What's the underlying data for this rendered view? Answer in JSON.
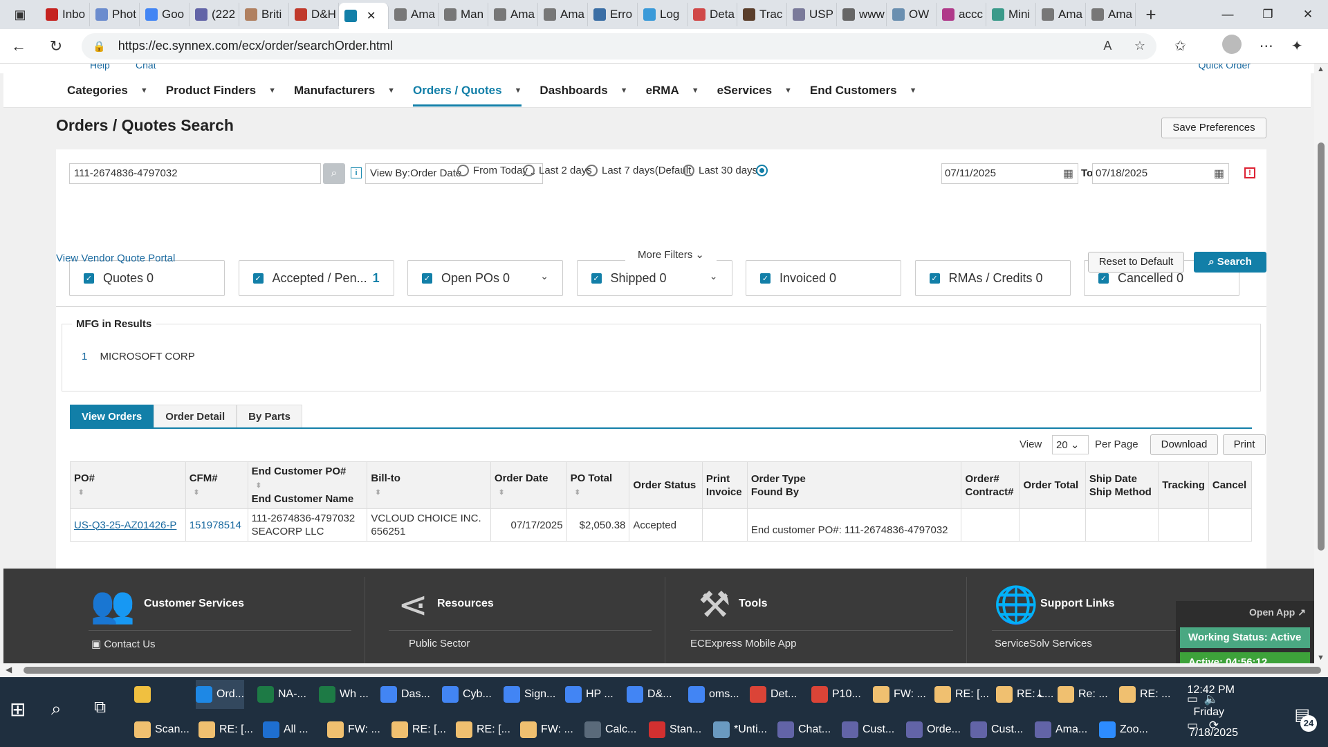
{
  "browser": {
    "tabs": [
      {
        "label": "Inbo",
        "color": "#c5221f"
      },
      {
        "label": "Phot",
        "color": "#6b8cce"
      },
      {
        "label": "Goo",
        "color": "#4285f4"
      },
      {
        "label": "(222",
        "color": "#6264a7"
      },
      {
        "label": "Briti",
        "color": "#b08060"
      },
      {
        "label": "D&H",
        "color": "#c0392b"
      },
      {
        "label": "",
        "color": "#127fa8",
        "active": true
      },
      {
        "label": "Ama",
        "color": "#777777"
      },
      {
        "label": "Man",
        "color": "#777777"
      },
      {
        "label": "Ama",
        "color": "#777777"
      },
      {
        "label": "Ama",
        "color": "#777777"
      },
      {
        "label": "Erro",
        "color": "#3a6ea5"
      },
      {
        "label": "Log",
        "color": "#3a9ad9"
      },
      {
        "label": "Deta",
        "color": "#d04848"
      },
      {
        "label": "Trac",
        "color": "#5a3e2b"
      },
      {
        "label": "USP",
        "color": "#7a7a9a"
      },
      {
        "label": "www",
        "color": "#666666"
      },
      {
        "label": "OW",
        "color": "#6a8fb0"
      },
      {
        "label": "accc",
        "color": "#b03a8a"
      },
      {
        "label": "Mini",
        "color": "#3a9a8a"
      },
      {
        "label": "Ama",
        "color": "#777777"
      },
      {
        "label": "Ama",
        "color": "#777777"
      }
    ],
    "url": "https://ec.synnex.com/ecx/order/searchOrder.html"
  },
  "header": {
    "help": "Help",
    "chat": "Chat",
    "quick_order": "Quick Order",
    "nav": [
      {
        "label": "Categories"
      },
      {
        "label": "Product Finders"
      },
      {
        "label": "Manufacturers"
      },
      {
        "label": "Orders / Quotes",
        "active": true
      },
      {
        "label": "Dashboards"
      },
      {
        "label": "eRMA"
      },
      {
        "label": "eServices"
      },
      {
        "label": "End Customers"
      }
    ]
  },
  "page": {
    "title": "Orders / Quotes Search",
    "save_preferences": "Save Preferences"
  },
  "filters": {
    "search_value": "111-2674836-4797032",
    "view_by": "View By:Order Date",
    "radios": [
      {
        "label": "From Today",
        "selected": false
      },
      {
        "label": "Last 2 days",
        "selected": false
      },
      {
        "label": "Last 7 days(Default)",
        "selected": false
      },
      {
        "label": "Last 30 days",
        "selected": false
      },
      {
        "label": "",
        "selected": true
      }
    ],
    "date_from": "07/11/2025",
    "to_label": "To",
    "date_to": "07/18/2025",
    "statuses": [
      {
        "label": "Quotes 0",
        "count": ""
      },
      {
        "label": "Accepted / Pen...",
        "count": "1"
      },
      {
        "label": "Open POs 0",
        "count": "",
        "chevron": true
      },
      {
        "label": "Shipped 0",
        "count": "",
        "chevron": true
      },
      {
        "label": "Invoiced 0",
        "count": ""
      },
      {
        "label": "RMAs / Credits 0",
        "count": ""
      },
      {
        "label": "Cancelled 0",
        "count": ""
      }
    ],
    "vendor_portal": "View Vendor Quote Portal",
    "more_filters": "More Filters",
    "reset": "Reset to Default",
    "search": "Search"
  },
  "results": {
    "mfg_title": "MFG in Results",
    "mfg": [
      {
        "count": "1",
        "name": "MICROSOFT CORP"
      }
    ],
    "tabs": [
      {
        "label": "View Orders",
        "active": true
      },
      {
        "label": "Order Detail"
      },
      {
        "label": "By Parts"
      }
    ],
    "view_label": "View",
    "per_page_value": "20",
    "per_page_label": "Per Page",
    "download": "Download",
    "print": "Print",
    "columns": [
      {
        "line1": "PO#",
        "line2": "",
        "sort": true
      },
      {
        "line1": "CFM#",
        "line2": "",
        "sort": true
      },
      {
        "line1": "End Customer PO#",
        "line2": "End Customer Name",
        "sort": true
      },
      {
        "line1": "Bill-to",
        "line2": "",
        "sort": true
      },
      {
        "line1": "Order Date",
        "line2": "",
        "sort": true
      },
      {
        "line1": "PO Total",
        "line2": "",
        "sort": true
      },
      {
        "line1": "Order Status",
        "line2": ""
      },
      {
        "line1": "Print",
        "line2": "Invoice"
      },
      {
        "line1": "Order Type",
        "line2": "Found By"
      },
      {
        "line1": "Order#",
        "line2": "Contract#"
      },
      {
        "line1": "Order Total",
        "line2": ""
      },
      {
        "line1": "Ship Date",
        "line2": "Ship Method"
      },
      {
        "line1": "Tracking",
        "line2": ""
      },
      {
        "line1": "Cancel",
        "line2": ""
      }
    ],
    "rows": [
      {
        "po": "US-Q3-25-AZ01426-P",
        "cfm": "151978514",
        "ec_po": "111-2674836-4797032",
        "ec_name": "SEACORP LLC",
        "billto_name": "VCLOUD CHOICE INC.",
        "billto_id": "656251",
        "order_date": "07/17/2025",
        "po_total": "$2,050.38",
        "status": "Accepted",
        "print_invoice": "",
        "found_by": "End customer PO#: 111-2674836-4797032",
        "order_no": "",
        "order_total": "",
        "ship": "",
        "tracking": "",
        "cancel": ""
      }
    ]
  },
  "footer": {
    "columns": [
      {
        "title": "Customer Services",
        "link": "Contact Us",
        "icon": "people-icon"
      },
      {
        "title": "Resources",
        "link": "Public Sector",
        "icon": "share-icon"
      },
      {
        "title": "Tools",
        "link": "ECExpress Mobile App",
        "icon": "tools-icon"
      },
      {
        "title": "Support Links",
        "link": "ServiceSolv Services",
        "icon": "globe-icon"
      }
    ]
  },
  "widget": {
    "open_app": "Open App",
    "working_status": "Working Status: Active",
    "active_timer": "Active: 04:56:12"
  },
  "taskbar": {
    "row1": [
      {
        "label": "",
        "color": "#f0c040"
      },
      {
        "label": "Ord...",
        "color": "#1e88e5",
        "selected": true
      },
      {
        "label": "NA-...",
        "color": "#1d7a45"
      },
      {
        "label": "Wh ...",
        "color": "#1d7a45"
      },
      {
        "label": "Das...",
        "color": "#4285f4"
      },
      {
        "label": "Cyb...",
        "color": "#4285f4"
      },
      {
        "label": "Sign...",
        "color": "#4285f4"
      },
      {
        "label": "HP ...",
        "color": "#4285f4"
      },
      {
        "label": "D&...",
        "color": "#4285f4"
      },
      {
        "label": "oms...",
        "color": "#4285f4"
      },
      {
        "label": "Det...",
        "color": "#db4437"
      },
      {
        "label": "P10...",
        "color": "#db4437"
      },
      {
        "label": "FW: ...",
        "color": "#f0c070"
      },
      {
        "label": "RE: [...",
        "color": "#f0c070"
      },
      {
        "label": "RE: L...",
        "color": "#f0c070"
      },
      {
        "label": "Re: ...",
        "color": "#f0c070"
      },
      {
        "label": "RE: ...",
        "color": "#f0c070"
      }
    ],
    "row2": [
      {
        "label": "Scan...",
        "color": "#f0c070"
      },
      {
        "label": "RE: [...",
        "color": "#f0c070"
      },
      {
        "label": "All ...",
        "color": "#1e6fd0"
      },
      {
        "label": "FW: ...",
        "color": "#f0c070"
      },
      {
        "label": "RE: [...",
        "color": "#f0c070"
      },
      {
        "label": "RE: [...",
        "color": "#f0c070"
      },
      {
        "label": "FW: ...",
        "color": "#f0c070"
      },
      {
        "label": "Calc...",
        "color": "#5a6a7a"
      },
      {
        "label": "Stan...",
        "color": "#d23030"
      },
      {
        "label": "*Unti...",
        "color": "#6a9ac0"
      },
      {
        "label": "Chat...",
        "color": "#6264a7"
      },
      {
        "label": "Cust...",
        "color": "#6264a7"
      },
      {
        "label": "Orde...",
        "color": "#6264a7"
      },
      {
        "label": "Cust...",
        "color": "#6264a7"
      },
      {
        "label": "Ama...",
        "color": "#6264a7"
      },
      {
        "label": "Zoo...",
        "color": "#2d8cff"
      }
    ],
    "time": "12:42 PM",
    "day": "Friday",
    "date": "7/18/2025",
    "notifications": "24"
  }
}
